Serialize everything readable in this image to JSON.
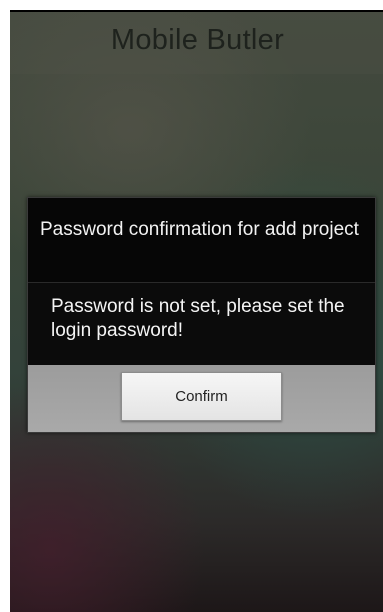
{
  "app": {
    "title": "Mobile Butler"
  },
  "dialog": {
    "title": "Password confirmation for add project",
    "message": "Password is not set, please set the login password!",
    "confirm_label": "Confirm"
  }
}
